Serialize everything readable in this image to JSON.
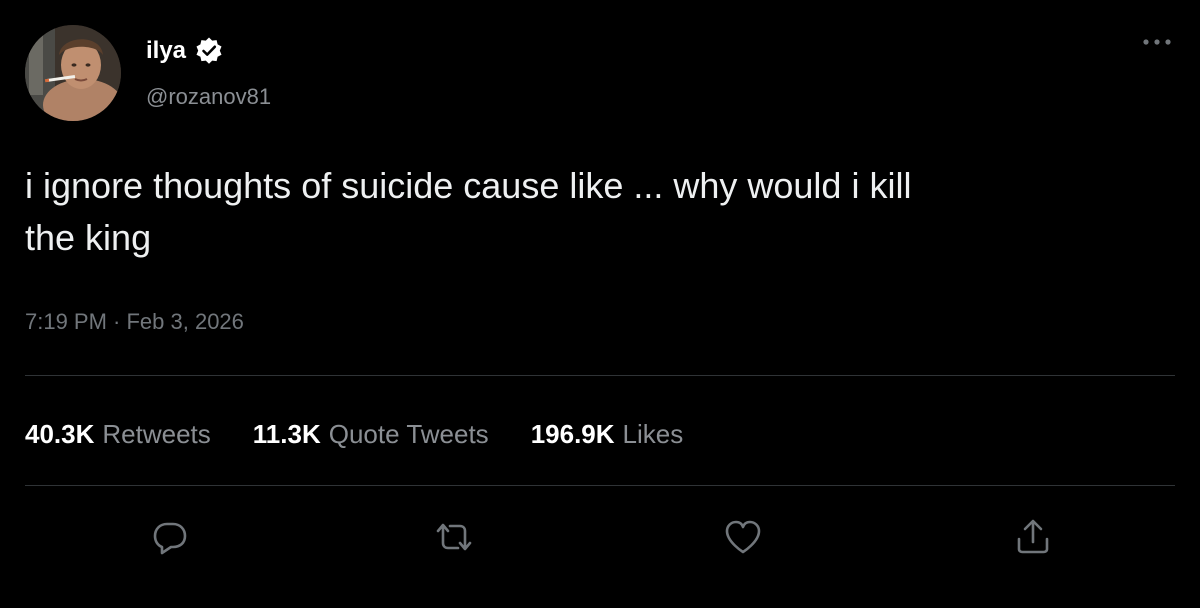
{
  "author": {
    "display_name": "ilya",
    "handle": "@rozanov81",
    "verified": true
  },
  "tweet": {
    "text": "i ignore thoughts of suicide cause like ... why would i kill\nthe king",
    "timestamp": "7:19 PM · Feb 3, 2026"
  },
  "stats": {
    "retweets_count": "40.3K",
    "retweets_label": "Retweets",
    "quotes_count": "11.3K",
    "quotes_label": "Quote Tweets",
    "likes_count": "196.9K",
    "likes_label": "Likes"
  },
  "actions": {
    "reply_icon": "reply-icon",
    "retweet_icon": "retweet-icon",
    "like_icon": "heart-icon",
    "share_icon": "share-icon"
  },
  "colors": {
    "background": "#000000",
    "primary_text": "#e7e9ea",
    "secondary_text": "#71767b",
    "divider": "#2f3336"
  }
}
